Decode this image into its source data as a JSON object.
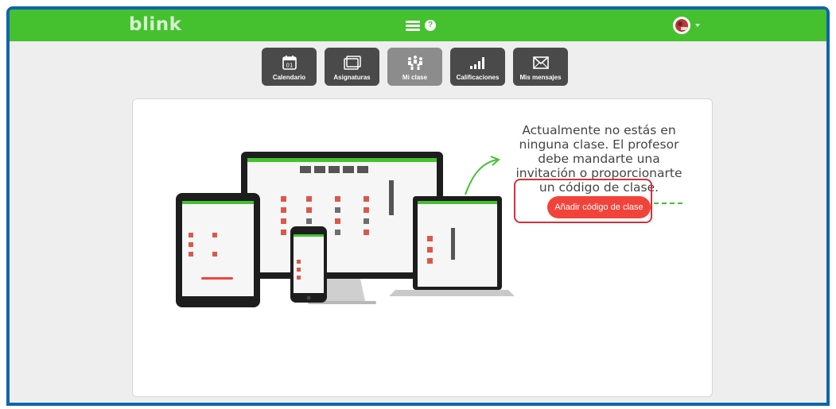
{
  "app": {
    "logo": "blink"
  },
  "nav": {
    "items": [
      {
        "label": "Calendario",
        "icon": "calendar-icon",
        "active": false
      },
      {
        "label": "Asignaturas",
        "icon": "subjects-icon",
        "active": false
      },
      {
        "label": "Mi clase",
        "icon": "class-icon",
        "active": true
      },
      {
        "label": "Calificaciones",
        "icon": "grades-icon",
        "active": false
      },
      {
        "label": "Mis mensajes",
        "icon": "envelope-icon",
        "active": false
      }
    ],
    "calendar_day": "01"
  },
  "main": {
    "message": "Actualmente no estás en ninguna clase. El profesor debe mandarte una invitación o proporcionarte un código de clase.",
    "cta_label": "Añadir código de clase"
  },
  "colors": {
    "topbar": "#45c12f",
    "frame": "#0f65a8",
    "tile": "#4a4a4a",
    "tile_active": "#8c8c8c",
    "cta": "#f2433b",
    "highlight": "#d6303a",
    "dashed_line": "#45c12f"
  }
}
